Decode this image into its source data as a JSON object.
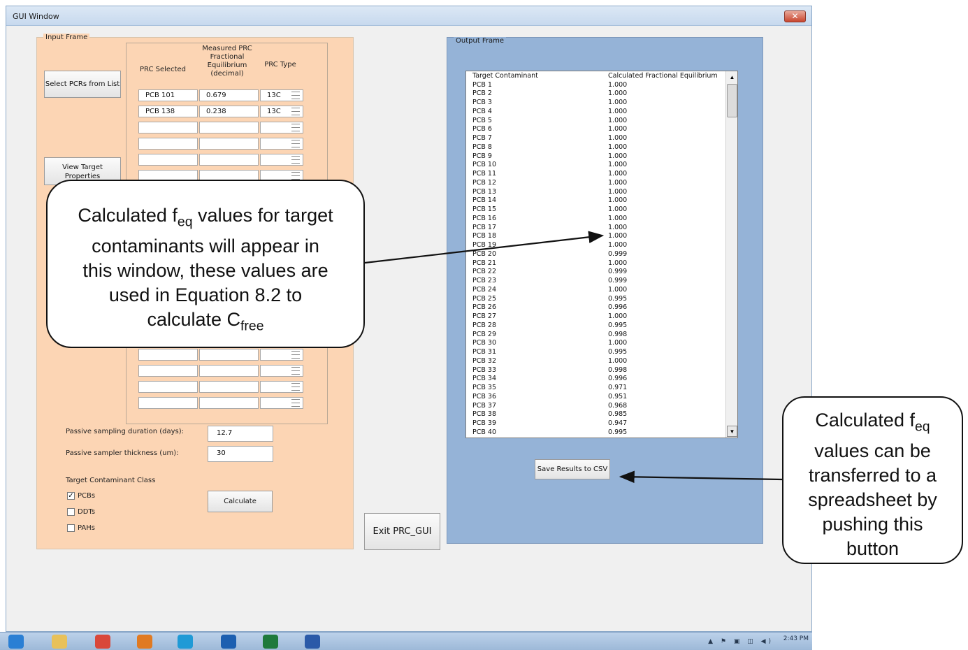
{
  "window": {
    "title": "GUI Window",
    "close_glyph": "✕"
  },
  "input_frame": {
    "legend": "Input Frame",
    "headers": {
      "prc_selected": "PRC Selected",
      "measured": "Measured PRC Fractional Equilibrium (decimal)",
      "prc_type": "PRC Type"
    },
    "select_button": "Select PCRs from List",
    "view_button": "View Target Properties",
    "rows": [
      {
        "name": "PCB 101",
        "value": "0.679",
        "type": "13C"
      },
      {
        "name": "PCB 138",
        "value": "0.238",
        "type": "13C"
      },
      {
        "name": "",
        "value": "",
        "type": ""
      },
      {
        "name": "",
        "value": "",
        "type": ""
      },
      {
        "name": "",
        "value": "",
        "type": ""
      },
      {
        "name": "",
        "value": "",
        "type": ""
      },
      {
        "name": "",
        "value": "",
        "type": ""
      },
      {
        "name": "",
        "value": "",
        "type": ""
      },
      {
        "name": "",
        "value": "",
        "type": ""
      },
      {
        "name": "",
        "value": "",
        "type": ""
      }
    ],
    "duration_label": "Passive sampling duration (days):",
    "duration_value": "12.7",
    "thickness_label": "Passive sampler thickness (um):",
    "thickness_value": "30",
    "class_label": "Target Contaminant Class",
    "classes": [
      {
        "label": "PCBs",
        "checked": true,
        "mark": "✓"
      },
      {
        "label": "DDTs",
        "checked": false,
        "mark": ""
      },
      {
        "label": "PAHs",
        "checked": false,
        "mark": ""
      }
    ],
    "calculate_button": "Calculate"
  },
  "exit_button": "Exit PRC_GUI",
  "output_frame": {
    "legend": "Output Frame",
    "list_headers": [
      "Target Contaminant",
      "Calculated Fractional Equilibrium"
    ],
    "rows": [
      [
        "PCB 1",
        "1.000"
      ],
      [
        "PCB 2",
        "1.000"
      ],
      [
        "PCB 3",
        "1.000"
      ],
      [
        "PCB 4",
        "1.000"
      ],
      [
        "PCB 5",
        "1.000"
      ],
      [
        "PCB 6",
        "1.000"
      ],
      [
        "PCB 7",
        "1.000"
      ],
      [
        "PCB 8",
        "1.000"
      ],
      [
        "PCB 9",
        "1.000"
      ],
      [
        "PCB 10",
        "1.000"
      ],
      [
        "PCB 11",
        "1.000"
      ],
      [
        "PCB 12",
        "1.000"
      ],
      [
        "PCB 13",
        "1.000"
      ],
      [
        "PCB 14",
        "1.000"
      ],
      [
        "PCB 15",
        "1.000"
      ],
      [
        "PCB 16",
        "1.000"
      ],
      [
        "PCB 17",
        "1.000"
      ],
      [
        "PCB 18",
        "1.000"
      ],
      [
        "PCB 19",
        "1.000"
      ],
      [
        "PCB 20",
        "0.999"
      ],
      [
        "PCB 21",
        "1.000"
      ],
      [
        "PCB 22",
        "0.999"
      ],
      [
        "PCB 23",
        "0.999"
      ],
      [
        "PCB 24",
        "1.000"
      ],
      [
        "PCB 25",
        "0.995"
      ],
      [
        "PCB 26",
        "0.996"
      ],
      [
        "PCB 27",
        "1.000"
      ],
      [
        "PCB 28",
        "0.995"
      ],
      [
        "PCB 29",
        "0.998"
      ],
      [
        "PCB 30",
        "1.000"
      ],
      [
        "PCB 31",
        "0.995"
      ],
      [
        "PCB 32",
        "1.000"
      ],
      [
        "PCB 33",
        "0.998"
      ],
      [
        "PCB 34",
        "0.996"
      ],
      [
        "PCB 35",
        "0.971"
      ],
      [
        "PCB 36",
        "0.951"
      ],
      [
        "PCB 37",
        "0.968"
      ],
      [
        "PCB 38",
        "0.985"
      ],
      [
        "PCB 39",
        "0.947"
      ],
      [
        "PCB 40",
        "0.995"
      ]
    ],
    "scroll_up": "▲",
    "scroll_down": "▼",
    "save_button": "Save Results to CSV"
  },
  "callouts": {
    "left": {
      "line1_pre": "Calculated f",
      "line1_sub": "eq",
      "line1_post": " values for target",
      "line2": "contaminants will appear in",
      "line3": "this window, these values are",
      "line4": "used in Equation 8.2 to",
      "line5_pre": "calculate C",
      "line5_sub": "free"
    },
    "right": {
      "line1_pre": "Calculated f",
      "line1_sub": "eq",
      "line2": "values can be",
      "line3": "transferred to a",
      "line4": "spreadsheet by",
      "line5": "pushing this",
      "line6": "button"
    }
  },
  "taskbar": {
    "apps": [
      {
        "name": "internet-explorer-icon",
        "color": "#2a7fd4"
      },
      {
        "name": "file-explorer-icon",
        "color": "#e8c15a"
      },
      {
        "name": "chrome-icon",
        "color": "#d9473a"
      },
      {
        "name": "media-player-icon",
        "color": "#e07a22"
      },
      {
        "name": "skype-icon",
        "color": "#1f9ad6"
      },
      {
        "name": "outlook-icon",
        "color": "#1c5fb0"
      },
      {
        "name": "excel-icon",
        "color": "#1f7a3c"
      },
      {
        "name": "word-icon",
        "color": "#2b5aa8"
      }
    ],
    "tray": "▲ ⚑ ▣ ◫ ◀)",
    "time": "2:43 PM"
  },
  "colors": {
    "input_frame_bg": "#fcd5b4",
    "output_frame_bg": "#95b3d7",
    "arrow": "#111111"
  }
}
